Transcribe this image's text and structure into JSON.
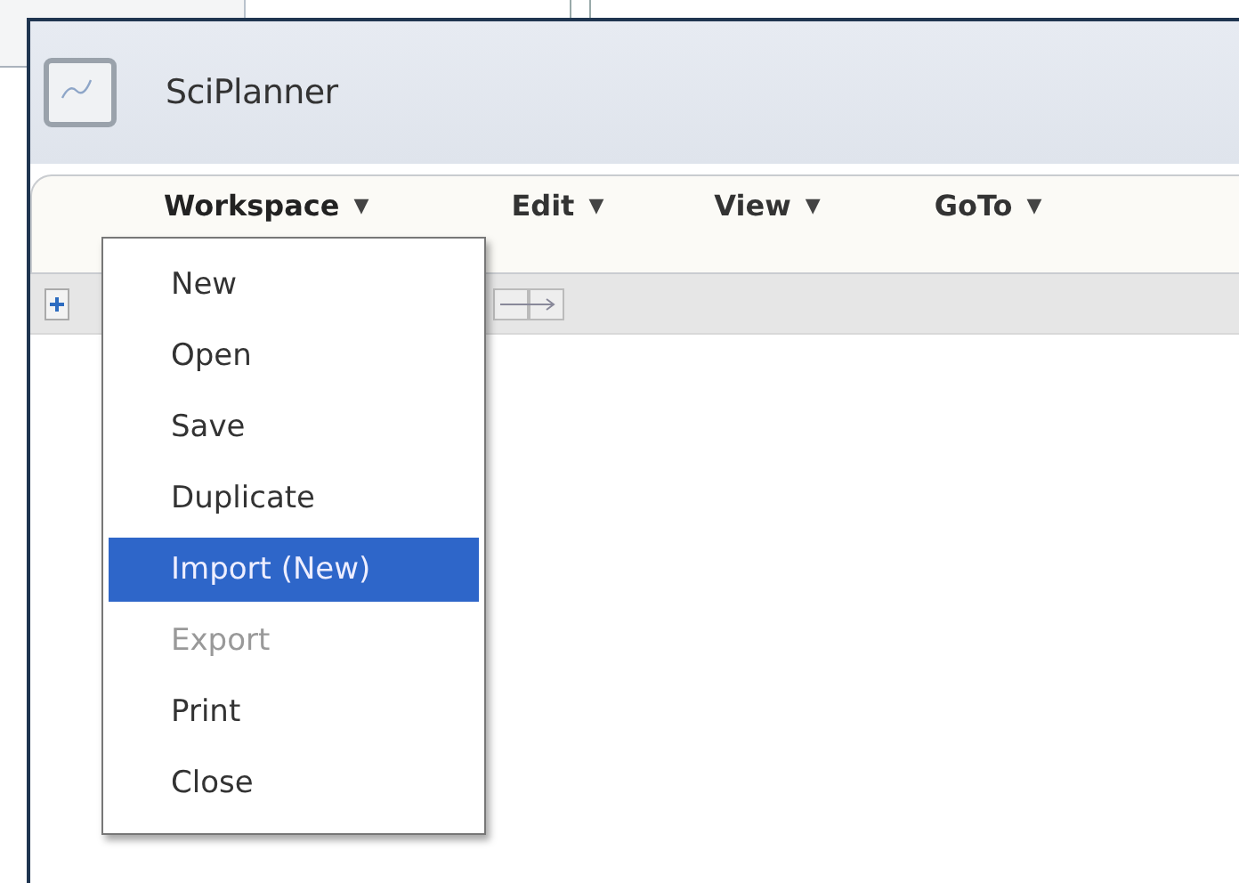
{
  "window": {
    "title": "SciPlanner"
  },
  "menu_bar": [
    {
      "label": "Workspace",
      "caret": "▼",
      "expanded": true
    },
    {
      "label": "Edit",
      "caret": "▼",
      "expanded": false
    },
    {
      "label": "View",
      "caret": "▼",
      "expanded": false
    },
    {
      "label": "GoTo",
      "caret": "▼",
      "expanded": false
    }
  ],
  "dropdown": {
    "items": [
      {
        "label": "New",
        "selected": false,
        "disabled": false
      },
      {
        "label": "Open",
        "selected": false,
        "disabled": false
      },
      {
        "label": "Save",
        "selected": false,
        "disabled": false
      },
      {
        "label": "Duplicate",
        "selected": false,
        "disabled": false
      },
      {
        "label": "Import (New)",
        "selected": true,
        "disabled": false
      },
      {
        "label": "Export",
        "selected": false,
        "disabled": true
      },
      {
        "label": "Print",
        "selected": false,
        "disabled": false
      },
      {
        "label": "Close",
        "selected": false,
        "disabled": false
      }
    ]
  }
}
